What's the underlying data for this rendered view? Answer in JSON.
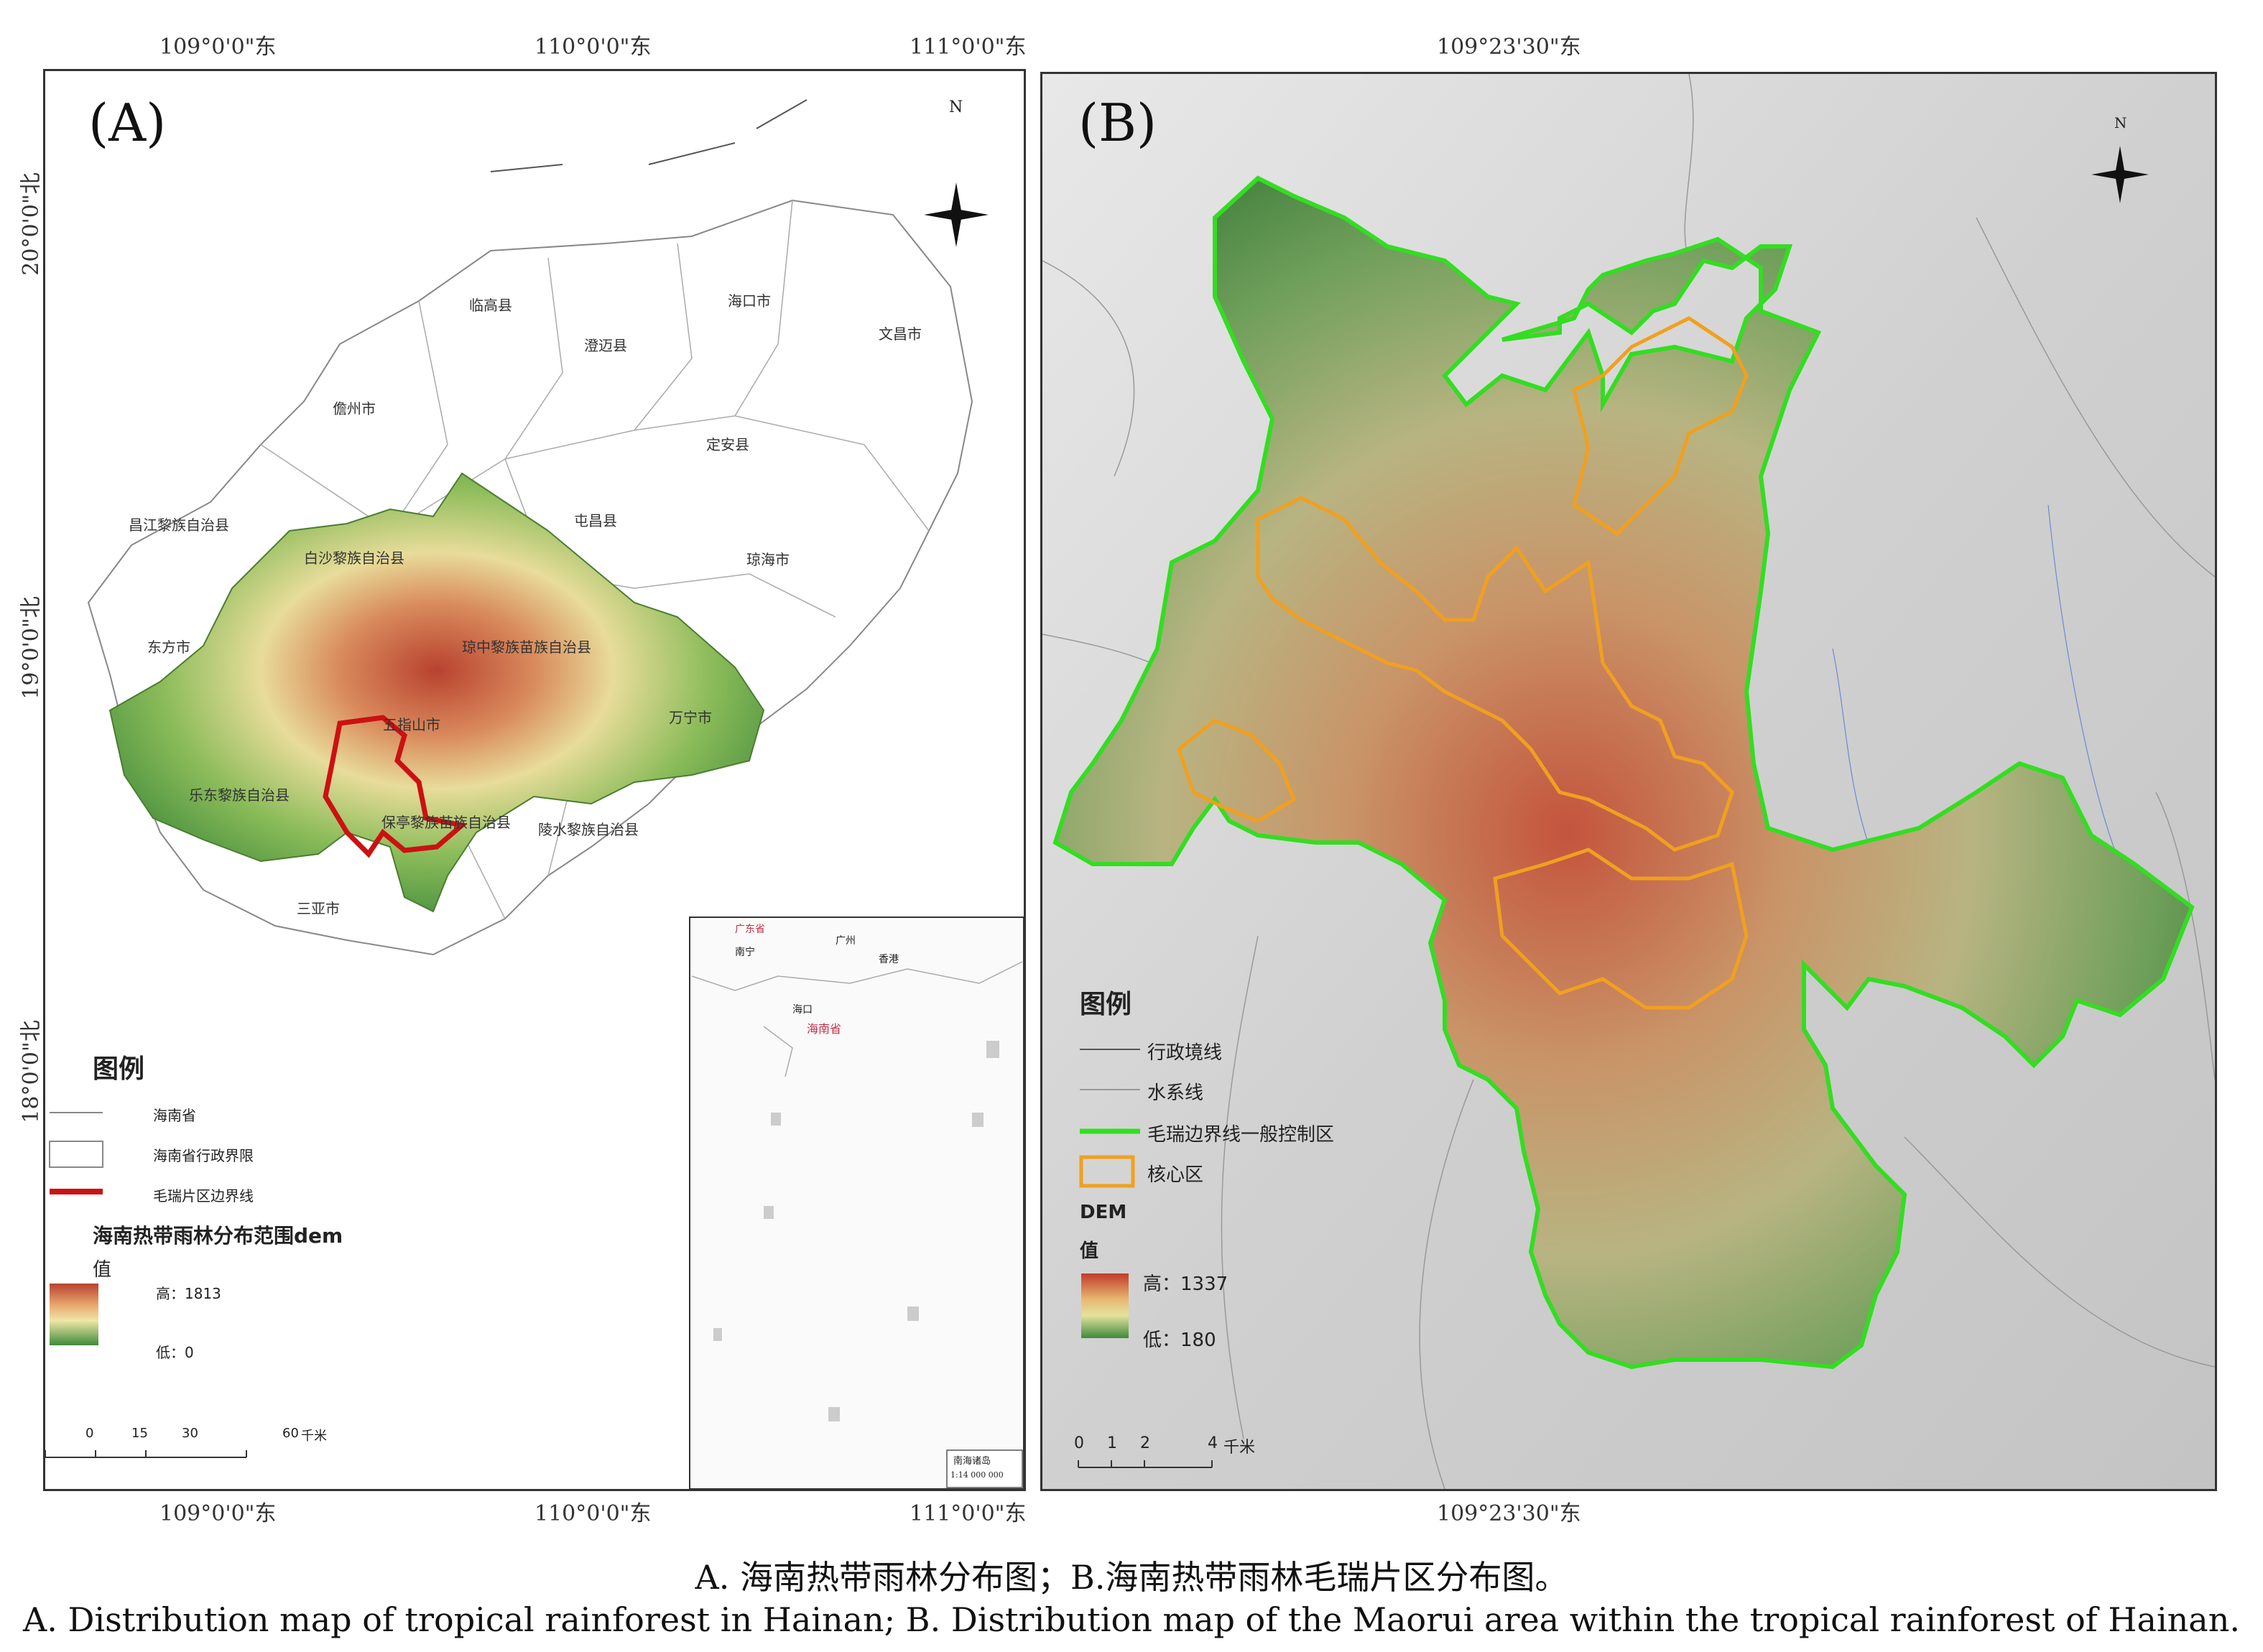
{
  "panel_a": {
    "label": "(A)",
    "coords_top": [
      "109°0'0\"东",
      "110°0'0\"东",
      "111°0'0\"东"
    ],
    "coords_bottom": [
      "109°0'0\"东",
      "110°0'0\"东",
      "111°0'0\"东"
    ],
    "coords_left": [
      "20°0'0\"北",
      "19°0'0\"北",
      "18°0'0\"北"
    ],
    "regions": [
      "临高县",
      "澄迈县",
      "海口市",
      "文昌市",
      "儋州市",
      "定安县",
      "屯昌县",
      "昌江黎族自治县",
      "白沙黎族自治县",
      "琼海市",
      "东方市",
      "琼中黎族苗族自治县",
      "五指山市",
      "万宁市",
      "乐东黎族自治县",
      "保亭黎族苗族自治县",
      "陵水黎族自治县",
      "三亚市"
    ],
    "legend": {
      "title": "图例",
      "items": [
        "海南省",
        "海南省行政界限",
        "毛瑞片区边界线"
      ],
      "dem_title": "海南热带雨林分布范围dem",
      "value_label": "值",
      "high": "高：1813",
      "low": "低：0"
    },
    "scale": {
      "ticks": [
        "0",
        "15",
        "30",
        "60"
      ],
      "unit": "千米"
    },
    "inset": {
      "labels": [
        "广东省",
        "海南省",
        "南宁",
        "广州",
        "香港",
        "海口",
        "南海诸岛"
      ],
      "scale_note": "1:14 000 000"
    },
    "north": "N"
  },
  "panel_b": {
    "label": "(B)",
    "coord_top": "109°23'30\"东",
    "coord_bottom": "109°23'30\"东",
    "north": "N",
    "legend": {
      "title": "图例",
      "items": [
        "行政境线",
        "水系线",
        "毛瑞边界线一般控制区",
        "核心区"
      ],
      "dem_title": "DEM",
      "value_label": "值",
      "high": "高：1337",
      "low": "低：180"
    },
    "scale": {
      "ticks": [
        "0",
        "1",
        "2",
        "4"
      ],
      "unit": "千米"
    }
  },
  "caption": {
    "zh": "A. 海南热带雨林分布图；B.海南热带雨林毛瑞片区分布图。",
    "en": "A. Distribution map of tropical rainforest in Hainan; B. Distribution map of the Maorui area within the tropical rainforest of Hainan."
  },
  "colors": {
    "boundary_red": "#cc1111",
    "boundary_green": "#33dd22",
    "core_orange": "#f0a020",
    "dem_high": "#b8422f",
    "dem_mid": "#e8dc9a",
    "dem_low": "#3f8a3a"
  }
}
